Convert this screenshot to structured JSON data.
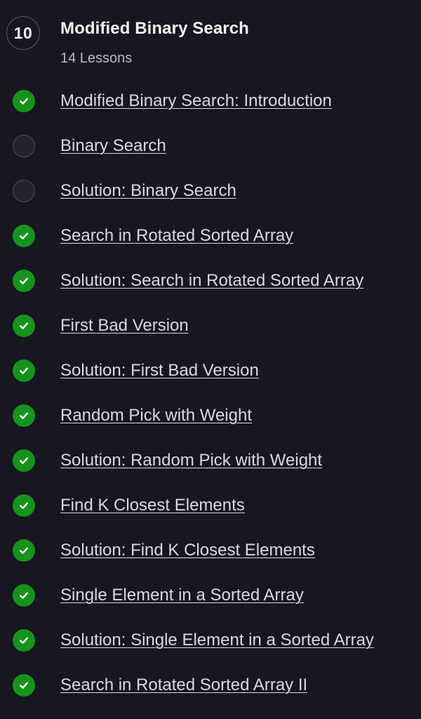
{
  "module": {
    "number": "10",
    "title": "Modified Binary Search",
    "lesson_count": "14 Lessons"
  },
  "lessons": [
    {
      "title": "Modified Binary Search: Introduction",
      "completed": true
    },
    {
      "title": "Binary Search",
      "completed": false
    },
    {
      "title": "Solution: Binary Search",
      "completed": false
    },
    {
      "title": "Search in Rotated Sorted Array",
      "completed": true
    },
    {
      "title": "Solution: Search in Rotated Sorted Array",
      "completed": true
    },
    {
      "title": "First Bad Version",
      "completed": true
    },
    {
      "title": "Solution: First Bad Version",
      "completed": true
    },
    {
      "title": "Random Pick with Weight",
      "completed": true
    },
    {
      "title": "Solution: Random Pick with Weight",
      "completed": true
    },
    {
      "title": "Find K Closest Elements",
      "completed": true
    },
    {
      "title": "Solution: Find K Closest Elements",
      "completed": true
    },
    {
      "title": "Single Element in a Sorted Array",
      "completed": true
    },
    {
      "title": "Solution: Single Element in a Sorted Array",
      "completed": true
    },
    {
      "title": "Search in Rotated Sorted Array II",
      "completed": true
    }
  ],
  "icons": {
    "completed": "check-circle-icon",
    "incomplete": "empty-circle-icon"
  },
  "colors": {
    "background": "#161721",
    "completed": "#17931d",
    "incomplete": "#23242f",
    "text": "#d9dadf"
  }
}
